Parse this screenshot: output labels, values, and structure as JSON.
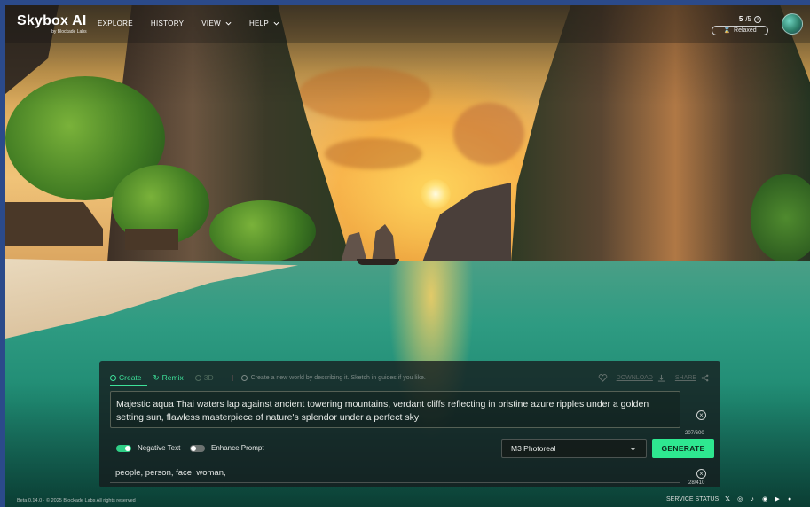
{
  "brand": {
    "name": "Skybox AI",
    "byline": "by Blockade Labs"
  },
  "nav": {
    "items": [
      {
        "label": "EXPLORE"
      },
      {
        "label": "HISTORY"
      },
      {
        "label": "VIEW"
      },
      {
        "label": "HELP"
      }
    ]
  },
  "credits": {
    "used": "5",
    "total": "/5",
    "mode": "Relaxed"
  },
  "panel": {
    "tabs": [
      {
        "label": "Create"
      },
      {
        "label": "Remix"
      },
      {
        "label": "3D"
      }
    ],
    "hint": "Create a new world by describing it. Sketch in guides if you like.",
    "download_label": "DOWNLOAD",
    "share_label": "SHARE",
    "prompt_text": "Majestic aqua Thai waters lap against ancient towering mountains, verdant cliffs reflecting in pristine azure ripples under a golden setting sun, flawless masterpiece of nature's splendor under a perfect sky",
    "prompt_count": "207/600",
    "negative_toggle_label": "Negative Text",
    "negative_toggle_on": true,
    "enhance_toggle_label": "Enhance Prompt",
    "enhance_toggle_on": false,
    "style_selected": "M3 Photoreal",
    "generate_label": "GENERATE",
    "negative_text": "people, person, face, woman,",
    "negative_count": "28/410"
  },
  "footer": {
    "left": "Beta 0.14.0  ·  © 2025 Blockade Labs All rights reserved",
    "status_label": "SERVICE STATUS",
    "socials": [
      "x-icon",
      "instagram-icon",
      "tiktok-icon",
      "discord-icon",
      "youtube-icon",
      "reddit-icon"
    ]
  },
  "colors": {
    "accent": "#2ee890",
    "panel_bg": "rgba(22,26,28,0.78)"
  }
}
